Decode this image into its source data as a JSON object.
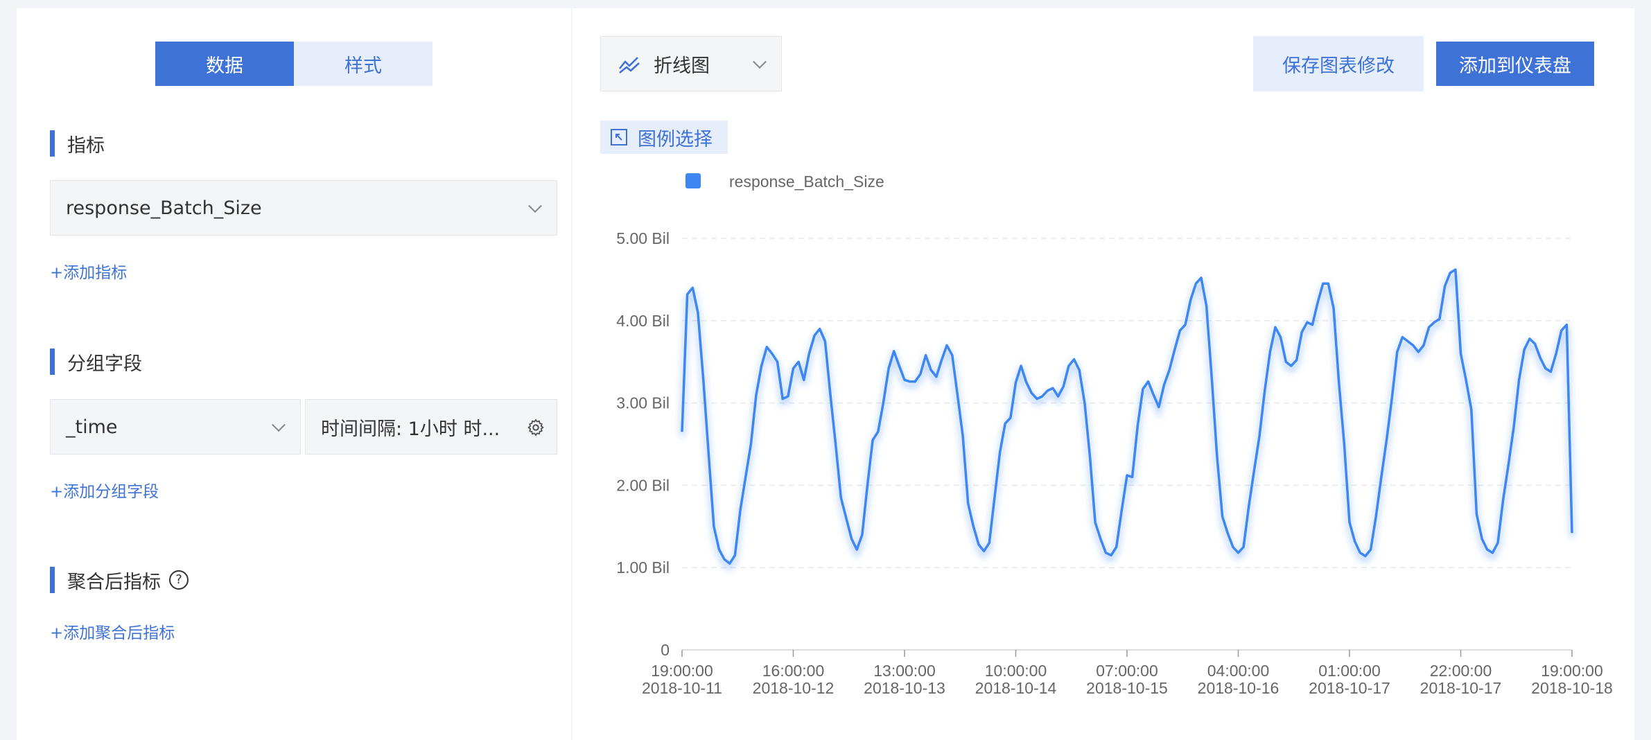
{
  "left": {
    "tabs": [
      {
        "label": "数据",
        "active": true
      },
      {
        "label": "样式",
        "active": false
      }
    ],
    "metrics": {
      "title": "指标",
      "selected": "response_Batch_Size",
      "add_link": "+添加指标"
    },
    "group": {
      "title": "分组字段",
      "field": "_time",
      "interval": "时间间隔: 1小时 时...",
      "add_link": "+添加分组字段"
    },
    "agg": {
      "title": "聚合后指标",
      "add_link": "+添加聚合后指标"
    }
  },
  "right": {
    "chart_type": "折线图",
    "save_label": "保存图表修改",
    "add_dashboard_label": "添加到仪表盘",
    "legend_select_label": "图例选择"
  },
  "chart_data": {
    "type": "line",
    "series": [
      {
        "name": "response_Batch_Size",
        "color": "#3e86f0",
        "values": [
          2.65,
          4.32,
          4.4,
          4.1,
          3.3,
          2.4,
          1.5,
          1.22,
          1.1,
          1.05,
          1.15,
          1.7,
          2.1,
          2.5,
          3.1,
          3.45,
          3.68,
          3.6,
          3.5,
          3.05,
          3.08,
          3.42,
          3.5,
          3.28,
          3.6,
          3.82,
          3.9,
          3.75,
          3.1,
          2.5,
          1.85,
          1.6,
          1.35,
          1.22,
          1.4,
          2.0,
          2.55,
          2.65,
          3.0,
          3.42,
          3.63,
          3.45,
          3.28,
          3.26,
          3.26,
          3.35,
          3.58,
          3.4,
          3.32,
          3.52,
          3.7,
          3.58,
          3.1,
          2.6,
          1.78,
          1.5,
          1.28,
          1.2,
          1.3,
          1.85,
          2.4,
          2.75,
          2.82,
          3.25,
          3.45,
          3.25,
          3.12,
          3.05,
          3.08,
          3.15,
          3.18,
          3.08,
          3.2,
          3.45,
          3.53,
          3.4,
          3.0,
          2.35,
          1.55,
          1.35,
          1.18,
          1.15,
          1.25,
          1.7,
          2.12,
          2.1,
          2.72,
          3.17,
          3.26,
          3.1,
          2.95,
          3.22,
          3.4,
          3.65,
          3.88,
          3.95,
          4.25,
          4.45,
          4.52,
          4.18,
          3.3,
          2.35,
          1.62,
          1.42,
          1.25,
          1.18,
          1.25,
          1.75,
          2.18,
          2.6,
          3.15,
          3.62,
          3.92,
          3.8,
          3.5,
          3.45,
          3.52,
          3.86,
          3.98,
          3.95,
          4.22,
          4.45,
          4.45,
          4.15,
          3.25,
          2.5,
          1.55,
          1.32,
          1.18,
          1.14,
          1.22,
          1.62,
          2.1,
          2.55,
          3.05,
          3.62,
          3.8,
          3.75,
          3.7,
          3.62,
          3.7,
          3.92,
          3.98,
          4.02,
          4.42,
          4.58,
          4.62,
          3.6,
          3.28,
          2.92,
          1.65,
          1.35,
          1.22,
          1.18,
          1.3,
          1.82,
          2.25,
          2.7,
          3.28,
          3.65,
          3.78,
          3.72,
          3.55,
          3.42,
          3.38,
          3.6,
          3.88,
          3.95,
          1.42
        ]
      }
    ],
    "x_tick_labels": [
      [
        "19:00:00",
        "2018-10-11"
      ],
      [
        "16:00:00",
        "2018-10-12"
      ],
      [
        "13:00:00",
        "2018-10-13"
      ],
      [
        "10:00:00",
        "2018-10-14"
      ],
      [
        "07:00:00",
        "2018-10-15"
      ],
      [
        "04:00:00",
        "2018-10-16"
      ],
      [
        "01:00:00",
        "2018-10-17"
      ],
      [
        "22:00:00",
        "2018-10-17"
      ],
      [
        "19:00:00",
        "2018-10-18"
      ]
    ],
    "y_ticks": [
      0,
      1,
      2,
      3,
      4,
      5
    ],
    "y_tick_labels": [
      "0",
      "1.00 Bil",
      "2.00 Bil",
      "3.00 Bil",
      "4.00 Bil",
      "5.00 Bil"
    ],
    "ylim": [
      0,
      5
    ],
    "grid": true,
    "legend_position": "top-left"
  }
}
